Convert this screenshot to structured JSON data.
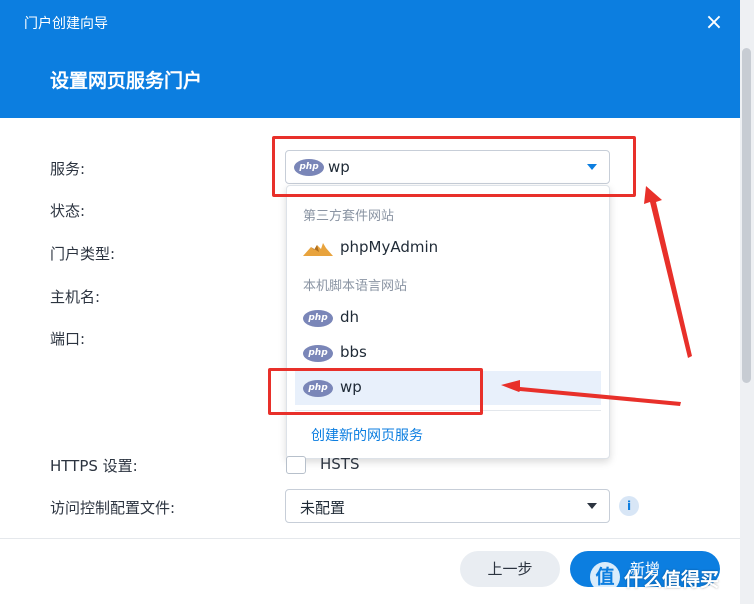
{
  "header": {
    "window_title": "门户创建向导",
    "close_glyph": "×",
    "step_title": "设置网页服务门户"
  },
  "form": {
    "service_label": "服务:",
    "status_label": "状态:",
    "portal_type_label": "门户类型:",
    "hostname_label": "主机名:",
    "port_label": "端口:",
    "https_label": "HTTPS 设置:",
    "hsts_label": "HSTS",
    "acl_label": "访问控制配置文件:",
    "service_value": "wp",
    "acl_value": "未配置",
    "info_glyph": "i"
  },
  "dropdown": {
    "group_third_party": "第三方套件网站",
    "group_local_script": "本机脚本语言网站",
    "options": [
      {
        "label": "phpMyAdmin",
        "icon": "phpmyadmin-icon"
      },
      {
        "label": "dh",
        "icon": "php-icon"
      },
      {
        "label": "bbs",
        "icon": "php-icon"
      },
      {
        "label": "wp",
        "icon": "php-icon",
        "selected": true
      }
    ],
    "create_link": "创建新的网页服务"
  },
  "php_badge": "php",
  "footer": {
    "prev_label": "上一步",
    "next_label": "新增"
  },
  "watermark": {
    "glyph": "值",
    "text": "什么值得买"
  },
  "colors": {
    "accent": "#0c7ee0",
    "annotation_red": "#e8302a"
  }
}
